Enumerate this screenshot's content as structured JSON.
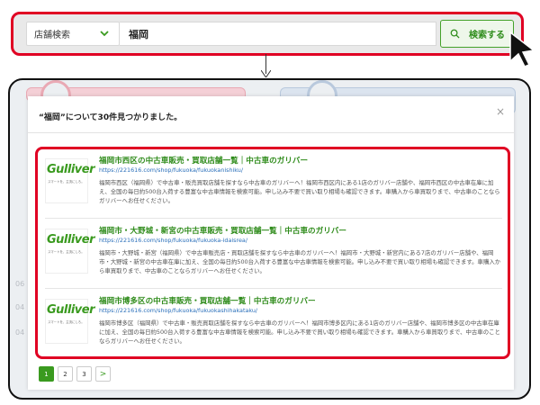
{
  "search": {
    "category_label": "店舗検索",
    "query": "福岡",
    "button_label": "検索する"
  },
  "background": {
    "side_labels": [
      "06",
      "04",
      "04"
    ]
  },
  "modal": {
    "title": "“福岡”について30件見つかりました。",
    "close": "×"
  },
  "results": [
    {
      "logo": "Gulliver",
      "tagline": "スマートを、主流にしろ。",
      "title": "福岡市西区の中古車販売・買取店舗一覧｜中古車のガリバー",
      "url": "https://221616.com/shop/fukuoka/fukuokanishiku/",
      "desc": "福岡市西区（福岡県）で中古車・販売買取店舗を探すなら中古車のガリバーへ！福岡市西区内にある1店のガリバー店舗や、福岡市西区の中古車在庫に加え、全国の毎日約500台入荷する豊富な中古車情報を検索可能。申し込み不要で買い取り相場も確認できます。車購入から車買取りまで、中古車のことならガリバーへお任せください。"
    },
    {
      "logo": "Gulliver",
      "tagline": "スマートを、主流にしろ。",
      "title": "福岡市・大野城・新宮の中古車販売・買取店舗一覧｜中古車のガリバー",
      "url": "https://221616.com/shop/fukuoka/fukuoka-idaisrea/",
      "desc": "福岡市・大野城・新宮（福岡県）で中古車販売店・買取店舗を探すなら中古車のガリバーへ！福岡市・大野城・新宮内にある7店のガリバー店舗や、福岡市・大野城・新宮の中古車在庫に加え、全国の毎日約500台入荷する豊富な中古車情報を検索可能。申し込み不要で買い取り相場も確認できます。車購入から車買取りまで、中古車のことならガリバーへお任せください。"
    },
    {
      "logo": "Gulliver",
      "tagline": "スマートを、主流にしろ。",
      "title": "福岡市博多区の中古車販売・買取店舗一覧｜中古車のガリバー",
      "url": "https://221616.com/shop/fukuoka/fukuokashihakataku/",
      "desc": "福岡市博多区（福岡県）で中古車・販売買取店舗を探すなら中古車のガリバーへ！福岡市博多区内にある1店のガリバー店舗や、福岡市博多区の中古車在庫に加え、全国の毎日約500台入荷する豊富な中古車情報を検索可能。申し込み不要で買い取り相場も確認できます。車購入から車買取りまで、中古車のことならガリバーへお任せください。"
    }
  ],
  "pagination": {
    "pages": [
      "1",
      "2",
      "3"
    ],
    "next": ">",
    "active": "1"
  },
  "colors": {
    "highlight": "#e00023",
    "brand_green": "#3a9a1f",
    "link_blue": "#2a6fba"
  }
}
